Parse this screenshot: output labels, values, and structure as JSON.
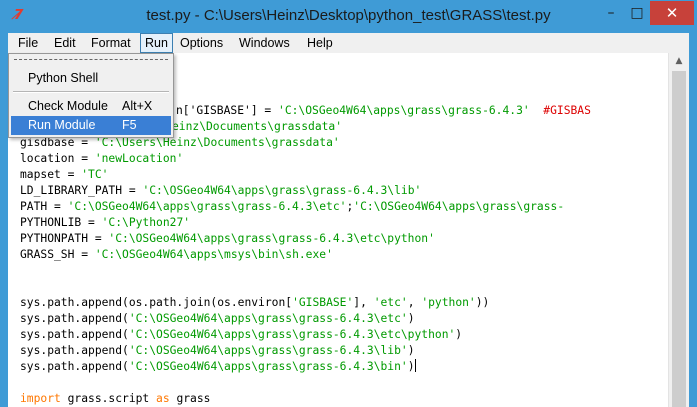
{
  "window": {
    "title": "test.py - C:\\Users\\Heinz\\Desktop\\python_test\\GRASS\\test.py",
    "app_icon_text": "7̸",
    "app_icon_color": "#e23b2e",
    "titlebar_color": "#3f9bd6",
    "buttons": {
      "minimize": "–",
      "maximize": "□",
      "close": "✕"
    }
  },
  "menubar": {
    "items": [
      "File",
      "Edit",
      "Format",
      "Run",
      "Options",
      "Windows",
      "Help"
    ],
    "active": "Run"
  },
  "run_menu": {
    "items": [
      {
        "label": "Python Shell",
        "accel": ""
      },
      {
        "label": "Check Module",
        "accel": "Alt+X"
      },
      {
        "label": "Run Module",
        "accel": "F5"
      }
    ],
    "selected": "Run Module",
    "selected_color": "#3a7fd5"
  },
  "editor": {
    "string_color": "#009a00",
    "comment_color": "#dd0000",
    "keyword_color": "#ff7700",
    "lines": [
      [
        {
          "t": "n",
          "v": "n['GISBASE'] = "
        },
        {
          "t": "s",
          "v": "'C:\\OSGeo4W64\\apps\\grass\\grass-6.4.3'"
        },
        {
          "t": "n",
          "v": "  "
        },
        {
          "t": "c",
          "v": "#GISBAS"
        }
      ],
      [
        {
          "t": "s",
          "v": "einz\\Documents\\grassdata'"
        }
      ],
      [
        {
          "t": "n",
          "v": "gisdbase = "
        },
        {
          "t": "s",
          "v": "'C:\\Users\\Heinz\\Documents\\grassdata'"
        }
      ],
      [
        {
          "t": "n",
          "v": "location = "
        },
        {
          "t": "s",
          "v": "'newLocation'"
        }
      ],
      [
        {
          "t": "n",
          "v": "mapset = "
        },
        {
          "t": "s",
          "v": "'TC'"
        }
      ],
      [
        {
          "t": "n",
          "v": "LD_LIBRARY_PATH = "
        },
        {
          "t": "s",
          "v": "'C:\\OSGeo4W64\\apps\\grass\\grass-6.4.3\\lib'"
        }
      ],
      [
        {
          "t": "n",
          "v": "PATH = "
        },
        {
          "t": "s",
          "v": "'C:\\OSGeo4W64\\apps\\grass\\grass-6.4.3\\etc'"
        },
        {
          "t": "n",
          "v": ";"
        },
        {
          "t": "s",
          "v": "'C:\\OSGeo4W64\\apps\\grass\\grass-"
        }
      ],
      [
        {
          "t": "n",
          "v": "PYTHONLIB = "
        },
        {
          "t": "s",
          "v": "'C:\\Python27'"
        }
      ],
      [
        {
          "t": "n",
          "v": "PYTHONPATH = "
        },
        {
          "t": "s",
          "v": "'C:\\OSGeo4W64\\apps\\grass\\grass-6.4.3\\etc\\python'"
        }
      ],
      [
        {
          "t": "n",
          "v": "GRASS_SH = "
        },
        {
          "t": "s",
          "v": "'C:\\OSGeo4W64\\apps\\msys\\bin\\sh.exe'"
        }
      ],
      [],
      [],
      [
        {
          "t": "n",
          "v": "sys.path.append(os.path.join(os.environ["
        },
        {
          "t": "s",
          "v": "'GISBASE'"
        },
        {
          "t": "n",
          "v": "], "
        },
        {
          "t": "s",
          "v": "'etc'"
        },
        {
          "t": "n",
          "v": ", "
        },
        {
          "t": "s",
          "v": "'python'"
        },
        {
          "t": "n",
          "v": "))"
        }
      ],
      [
        {
          "t": "n",
          "v": "sys.path.append("
        },
        {
          "t": "s",
          "v": "'C:\\OSGeo4W64\\apps\\grass\\grass-6.4.3\\etc'"
        },
        {
          "t": "n",
          "v": ")"
        }
      ],
      [
        {
          "t": "n",
          "v": "sys.path.append("
        },
        {
          "t": "s",
          "v": "'C:\\OSGeo4W64\\apps\\grass\\grass-6.4.3\\etc\\python'"
        },
        {
          "t": "n",
          "v": ")"
        }
      ],
      [
        {
          "t": "n",
          "v": "sys.path.append("
        },
        {
          "t": "s",
          "v": "'C:\\OSGeo4W64\\apps\\grass\\grass-6.4.3\\lib'"
        },
        {
          "t": "n",
          "v": ")"
        }
      ],
      [
        {
          "t": "n",
          "v": "sys.path.append("
        },
        {
          "t": "s",
          "v": "'C:\\OSGeo4W64\\apps\\grass\\grass-6.4.3\\bin'"
        },
        {
          "t": "n",
          "v": ")"
        },
        {
          "t": "cursor",
          "v": ""
        }
      ],
      [],
      [
        {
          "t": "k",
          "v": "import"
        },
        {
          "t": "n",
          "v": " grass.script "
        },
        {
          "t": "k",
          "v": "as"
        },
        {
          "t": "n",
          "v": " grass"
        }
      ]
    ]
  },
  "scrollbar": {
    "up_arrow": "▲"
  }
}
